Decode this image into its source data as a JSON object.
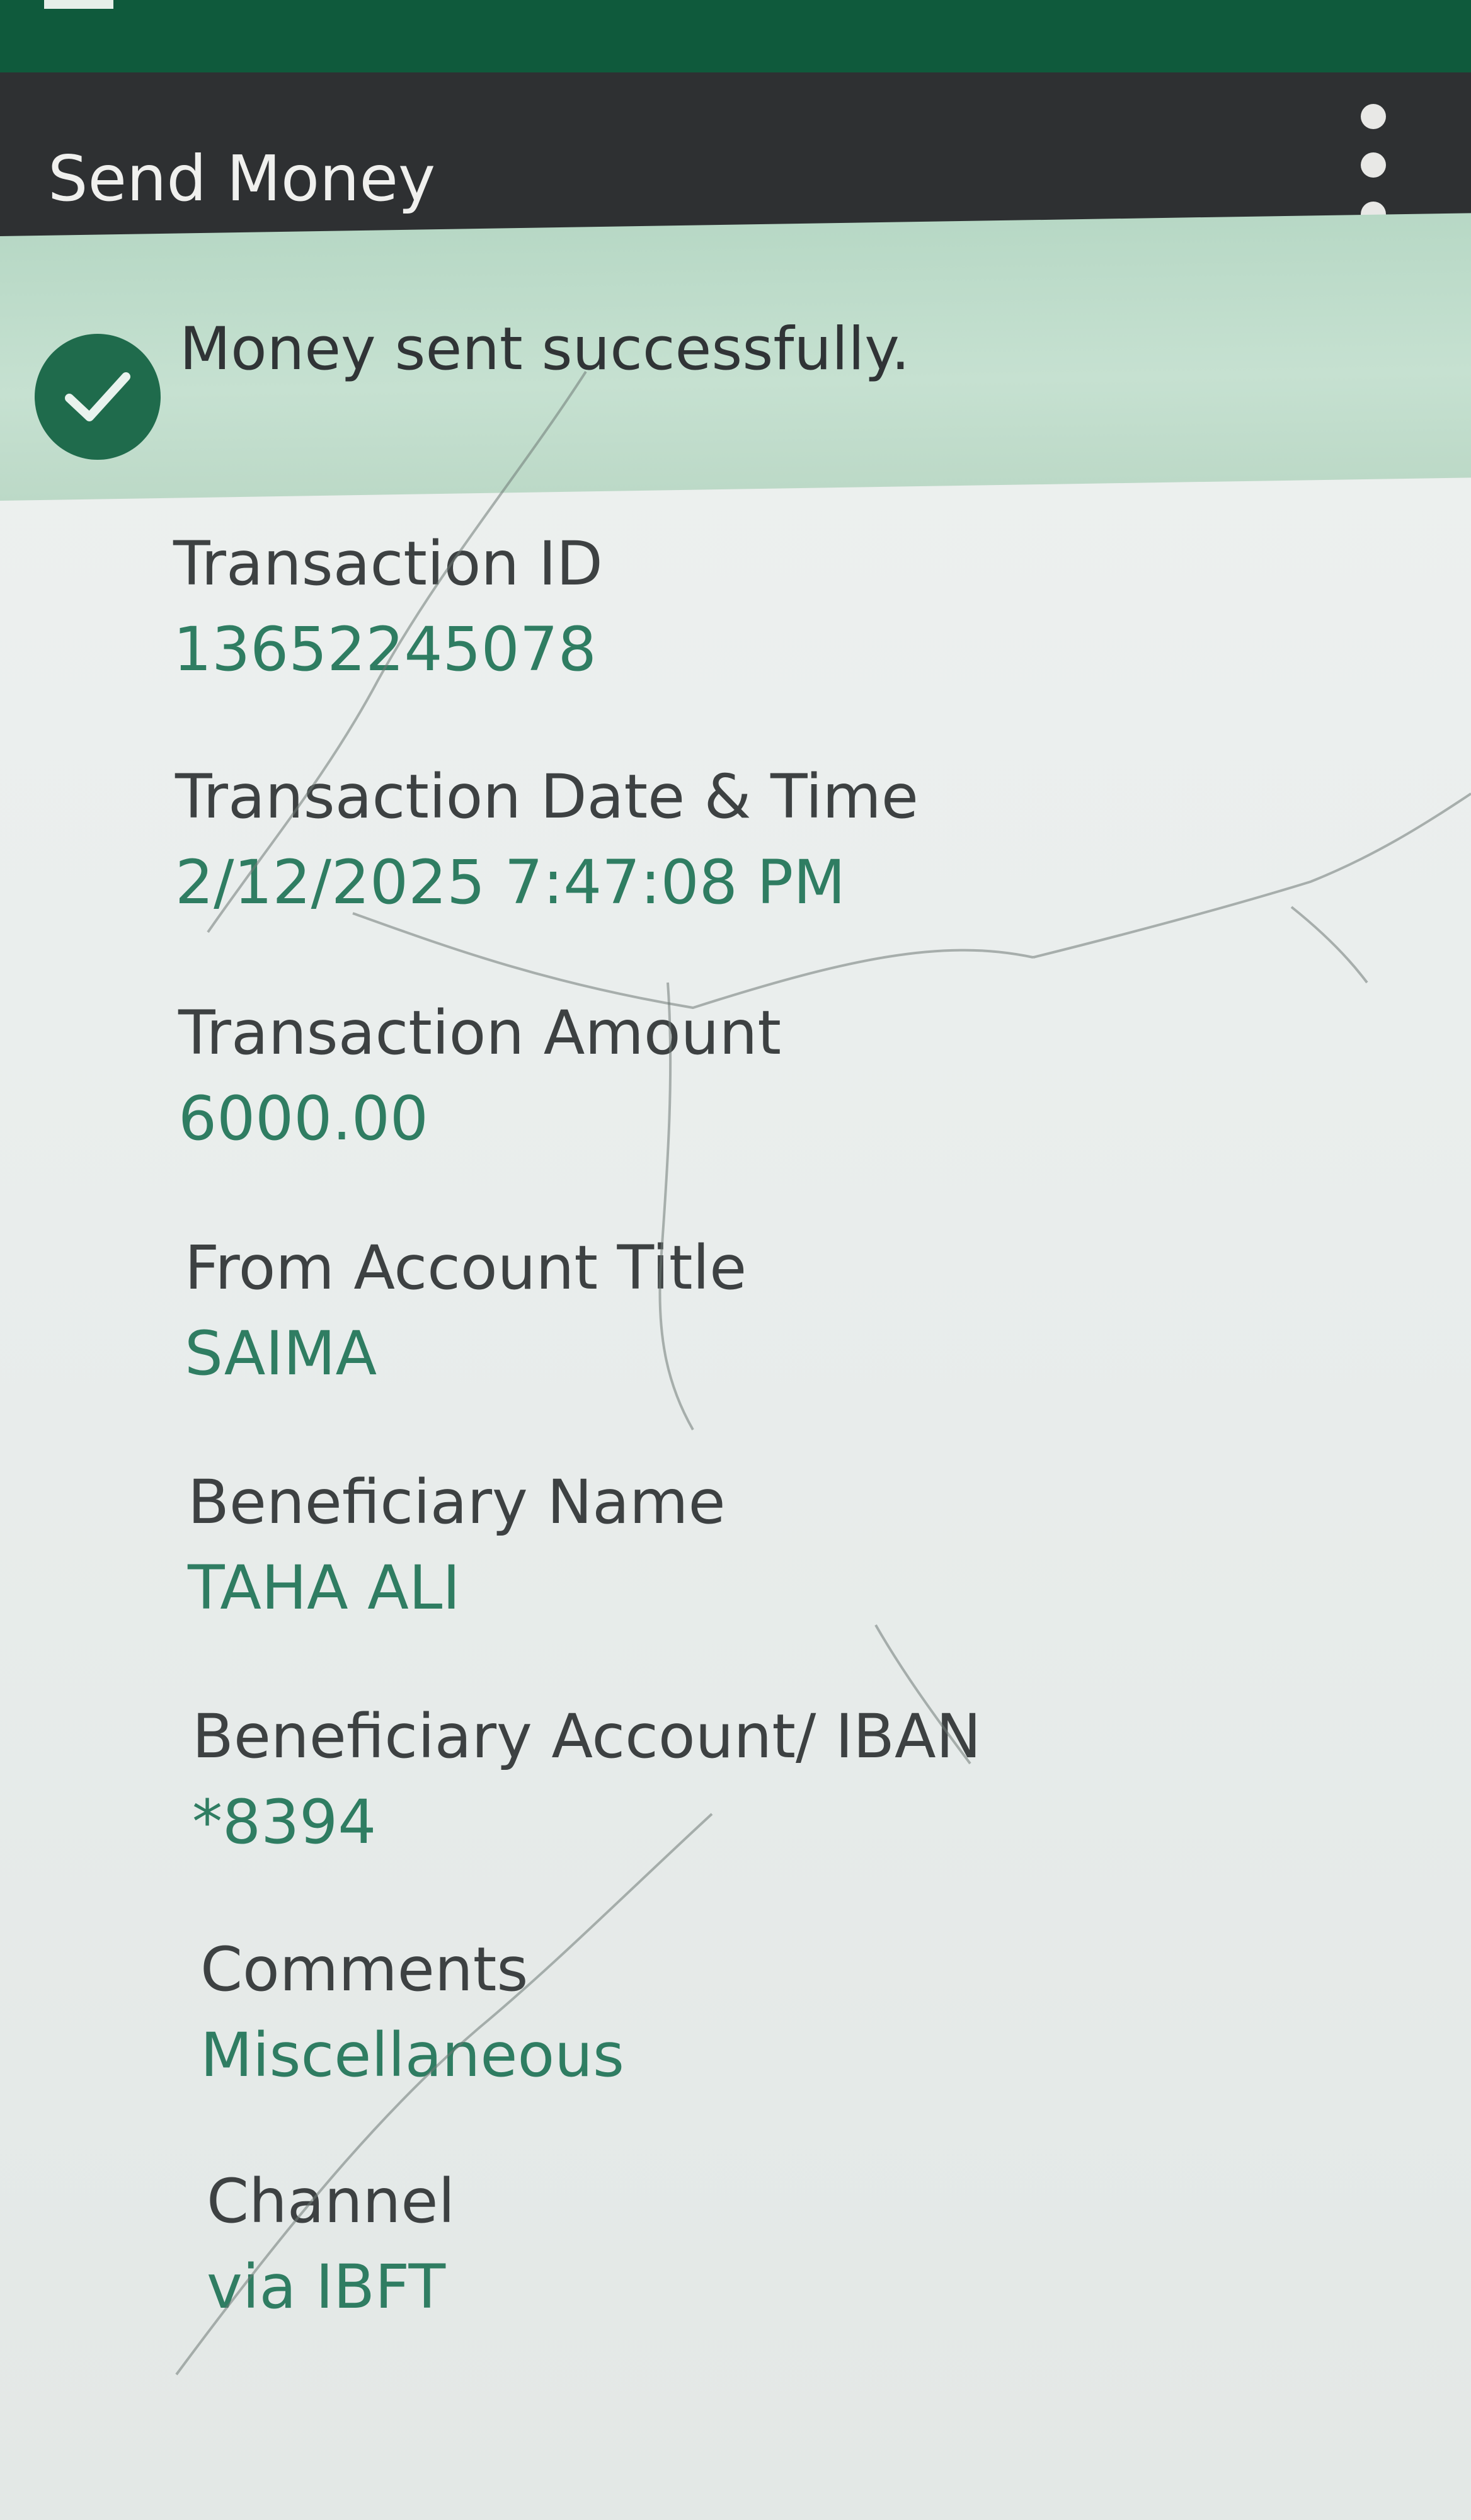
{
  "header": {
    "title": "Send Money"
  },
  "banner": {
    "message": "Money sent successfully."
  },
  "details": [
    {
      "label": "Transaction ID",
      "value": "13652245078"
    },
    {
      "label": "Transaction Date & Time",
      "value": "2/12/2025 7:47:08 PM"
    },
    {
      "label": "Transaction Amount",
      "value": "6000.00"
    },
    {
      "label": "From Account Title",
      "value": "SAIMA"
    },
    {
      "label": "Beneficiary Name",
      "value": "TAHA ALI"
    },
    {
      "label": "Beneficiary Account/ IBAN",
      "value": "*8394"
    },
    {
      "label": "Comments",
      "value": "Miscellaneous"
    },
    {
      "label": "Channel",
      "value": "via IBFT"
    }
  ],
  "icons": {
    "menu": "kebab-menu-icon",
    "success": "checkmark-circle-icon"
  },
  "colors": {
    "brand": "#0f5a3c",
    "header": "#2e3032",
    "banner": "#c3dfcd",
    "value_text": "#2f7d62",
    "label_text": "#3d4142"
  }
}
